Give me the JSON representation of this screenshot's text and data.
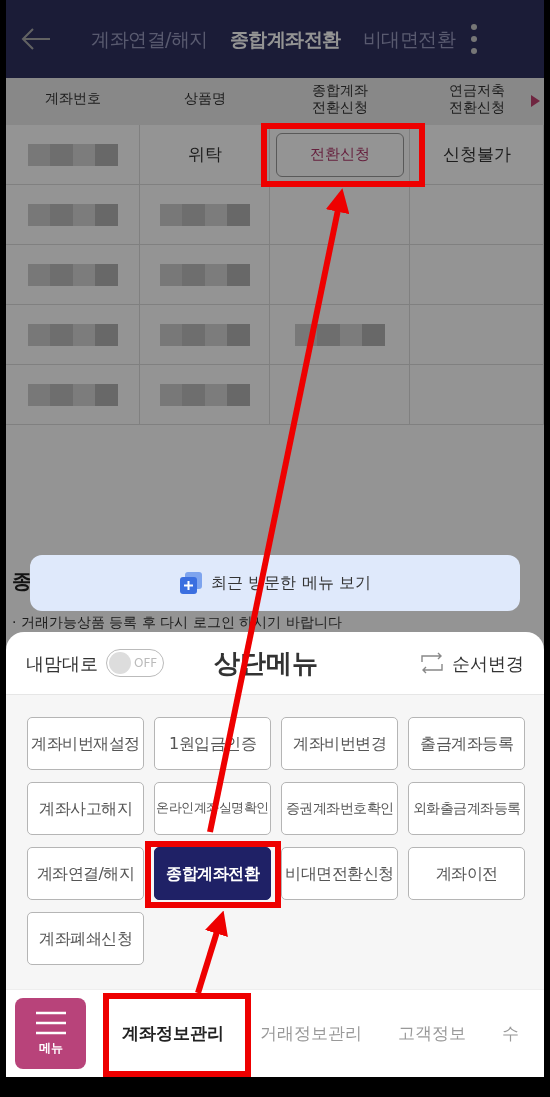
{
  "header": {
    "tabs": [
      {
        "label": "계좌연결/해지",
        "selected": false
      },
      {
        "label": "종합계좌전환",
        "selected": true
      },
      {
        "label": "비대면전환",
        "selected": false
      }
    ]
  },
  "table": {
    "columns": [
      "계좌번호",
      "상품명",
      "종합계좌\n전환신청",
      "연금저축\n전환신청"
    ],
    "rows": [
      {
        "cells": [
          {
            "kind": "redacted"
          },
          {
            "kind": "text",
            "text": "위탁"
          },
          {
            "kind": "button",
            "text": "전환신청"
          },
          {
            "kind": "text",
            "text": "신청불가"
          }
        ]
      },
      {
        "cells": [
          {
            "kind": "redacted"
          },
          {
            "kind": "redacted"
          },
          {
            "kind": "empty"
          },
          {
            "kind": "empty"
          }
        ]
      },
      {
        "cells": [
          {
            "kind": "redacted"
          },
          {
            "kind": "redacted"
          },
          {
            "kind": "empty"
          },
          {
            "kind": "empty"
          }
        ]
      },
      {
        "cells": [
          {
            "kind": "redacted"
          },
          {
            "kind": "redacted"
          },
          {
            "kind": "redacted"
          },
          {
            "kind": "empty"
          }
        ]
      },
      {
        "cells": [
          {
            "kind": "redacted"
          },
          {
            "kind": "redacted"
          },
          {
            "kind": "empty"
          },
          {
            "kind": "empty"
          }
        ]
      }
    ]
  },
  "section_heading": "종",
  "notice": "· 거래가능상품 등록 후 다시 로그인 하시기 바랍니다",
  "recent_menu_button": "최근 방문한 메뉴 보기",
  "sheet": {
    "toggle": {
      "label": "내맘대로",
      "on": false,
      "state_text": "OFF"
    },
    "title": "상단메뉴",
    "reorder": "순서변경",
    "items": [
      {
        "label": "계좌비번재설정",
        "selected": false
      },
      {
        "label": "1원입금인증",
        "selected": false
      },
      {
        "label": "계좌비번변경",
        "selected": false
      },
      {
        "label": "출금계좌등록",
        "selected": false
      },
      {
        "label": "계좌사고해지",
        "selected": false
      },
      {
        "label": "온라인계좌실명확인",
        "selected": false
      },
      {
        "label": "증권계좌번호확인",
        "selected": false
      },
      {
        "label": "외화출금계좌등록",
        "selected": false
      },
      {
        "label": "계좌연결/해지",
        "selected": false
      },
      {
        "label": "종합계좌전환",
        "selected": true
      },
      {
        "label": "비대면전환신청",
        "selected": false
      },
      {
        "label": "계좌이전",
        "selected": false
      },
      {
        "label": "계좌폐쇄신청",
        "selected": false
      }
    ]
  },
  "bottom_nav": {
    "menu_button": "메뉴",
    "tabs": [
      {
        "label": "계좌정보관리",
        "selected": true
      },
      {
        "label": "거래정보관리",
        "selected": false
      },
      {
        "label": "고객정보",
        "selected": false
      },
      {
        "label": "수",
        "selected": false
      }
    ]
  }
}
